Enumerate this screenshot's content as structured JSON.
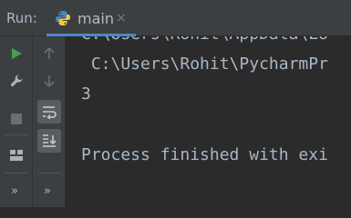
{
  "header": {
    "run_label": "Run:",
    "tab_label": "main",
    "tab_close": "×"
  },
  "toolbar_left": [
    "run-icon",
    "wrench-icon",
    "stop-icon",
    "layout-icon"
  ],
  "toolbar_mid": [
    "up-arrow-icon",
    "down-arrow-icon",
    "soft-wrap-icon",
    "scroll-to-end-icon"
  ],
  "more": "»",
  "console": {
    "lines": [
      "C:\\Users\\Rohit\\AppData\\Lo",
      " C:\\Users\\Rohit\\PycharmPr",
      "3",
      "",
      "Process finished with exi"
    ]
  },
  "colors": {
    "console_bg": "#2b2b2b",
    "toolbar_bg": "#3c3f41",
    "text": "#a9b7c6",
    "run_green": "#499c54",
    "accent": "#4a88c7"
  }
}
